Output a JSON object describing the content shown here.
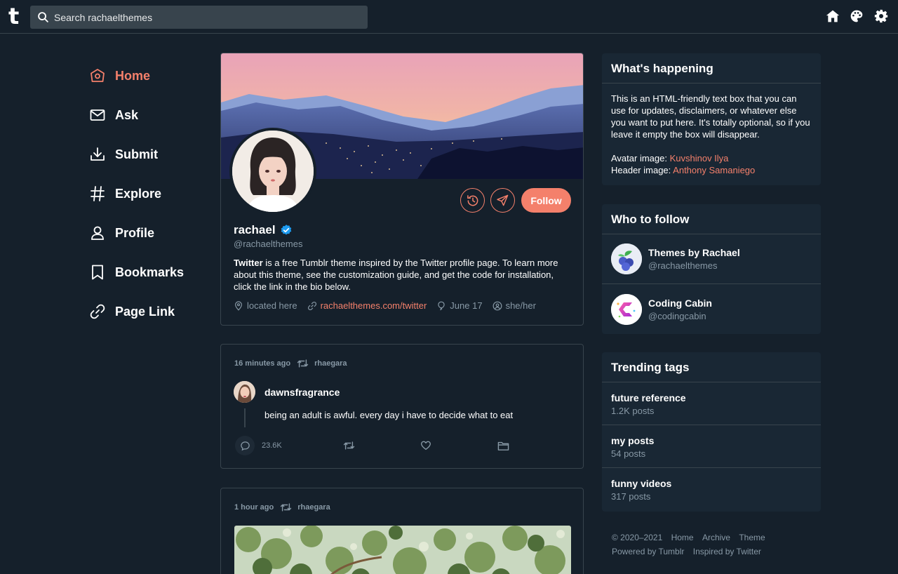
{
  "topbar": {
    "logo": "t",
    "search_placeholder": "Search rachaelthemes"
  },
  "nav": {
    "items": [
      {
        "label": "Home",
        "icon": "home-icon",
        "active": true
      },
      {
        "label": "Ask",
        "icon": "mail-icon",
        "active": false
      },
      {
        "label": "Submit",
        "icon": "download-icon",
        "active": false
      },
      {
        "label": "Explore",
        "icon": "hashtag-icon",
        "active": false
      },
      {
        "label": "Profile",
        "icon": "person-icon",
        "active": false
      },
      {
        "label": "Bookmarks",
        "icon": "bookmark-icon",
        "active": false
      },
      {
        "label": "Page Link",
        "icon": "link-icon",
        "active": false
      }
    ]
  },
  "profile": {
    "name": "rachael",
    "handle": "@rachaelthemes",
    "bio_bold": "Twitter",
    "bio_rest": " is a free Tumblr theme inspired by the Twitter profile page. To learn more about this theme, see the customization guide, and get the code for installation, click the link in the bio below.",
    "follow_label": "Follow",
    "location": "located here",
    "link": "rachaelthemes.com/twitter",
    "birthday": "June 17",
    "pronouns": "she/her"
  },
  "posts": [
    {
      "time": "16 minutes ago",
      "reblogger": "rhaegara",
      "author": "dawnsfragrance",
      "text": "being an adult is awful. every day i have to decide what to eat",
      "notes": "23.6K"
    },
    {
      "time": "1 hour ago",
      "reblogger": "rhaegara"
    }
  ],
  "happening": {
    "title": "What's happening",
    "text": "This is an HTML-friendly text box that you can use for updates, disclaimers, or whatever else you want to put here. It's totally optional, so if you leave it empty the box will disappear.",
    "avatar_label": "Avatar image: ",
    "avatar_credit": "Kuvshinov Ilya",
    "header_label": "Header image: ",
    "header_credit": "Anthony Samaniego"
  },
  "who_to_follow": {
    "title": "Who to follow",
    "accounts": [
      {
        "name": "Themes by Rachael",
        "handle": "@rachaelthemes"
      },
      {
        "name": "Coding Cabin",
        "handle": "@codingcabin"
      }
    ]
  },
  "trending": {
    "title": "Trending tags",
    "tags": [
      {
        "name": "future reference",
        "count": "1.2K posts"
      },
      {
        "name": "my posts",
        "count": "54 posts"
      },
      {
        "name": "funny videos",
        "count": "317 posts"
      }
    ]
  },
  "footer": {
    "copyright": "© 2020–2021",
    "links": [
      "Home",
      "Archive",
      "Theme"
    ],
    "powered": "Powered by Tumblr",
    "inspired": "Inspired by Twitter"
  },
  "colors": {
    "background": "#15202b",
    "accent": "#f4806b",
    "muted": "#8899a6",
    "border": "#38444d",
    "verified": "#1d9bf0"
  }
}
